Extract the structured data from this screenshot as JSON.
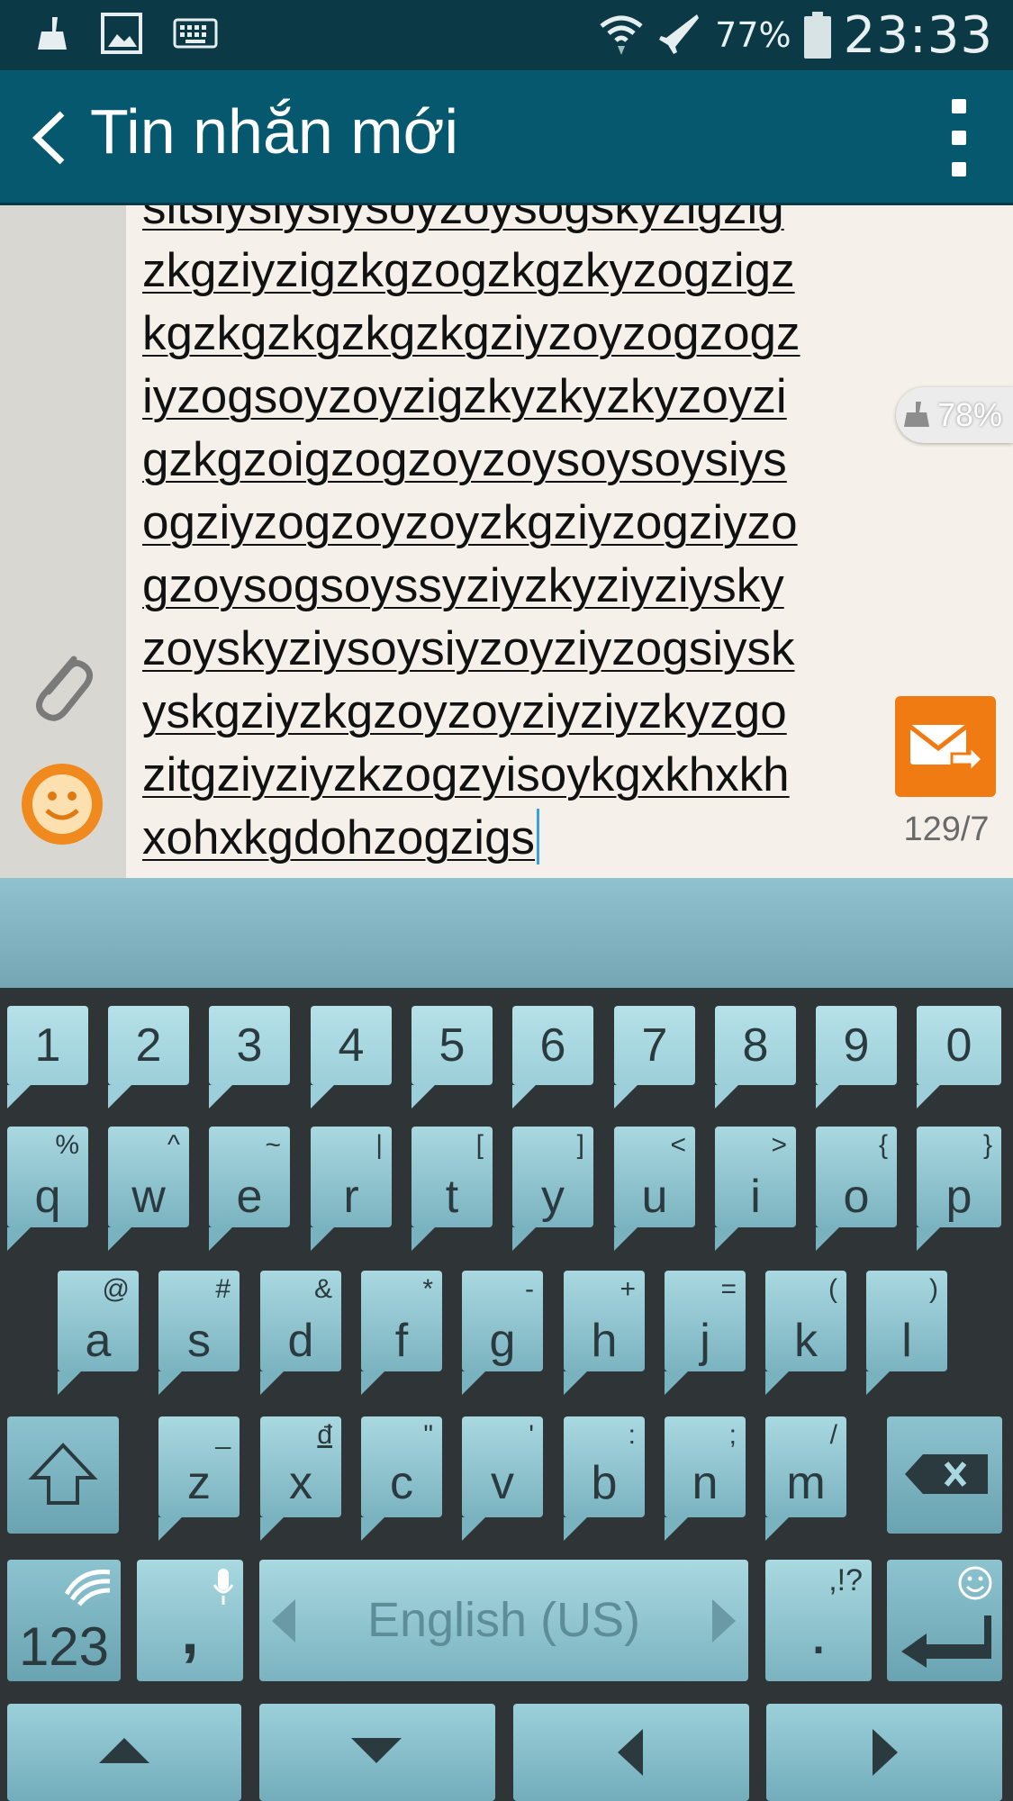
{
  "status_bar": {
    "battery_percent": "77%",
    "time": "23:33",
    "icons": [
      "broom-icon",
      "image-icon",
      "keyboard-icon",
      "wifi-icon",
      "airplane-mode-icon",
      "battery-icon"
    ]
  },
  "app_bar": {
    "title": "Tin nhắn mới",
    "back_icon": "chevron-left-icon",
    "menu_icon": "overflow-menu-icon"
  },
  "compose": {
    "message_lines": [
      "sitsiysiysiysoyzoysogskyzigzig",
      "zkgziyzigzkgzogzkgzkyzogzigz",
      "kgzkgzkgzkgzkgziyzoyzogzogz",
      "iyzogsoyzoyzigzkyzkyzkyzoyzi",
      "gzkgzoigzogzoyzoysoysoysiys",
      "ogziyzogzoyzoyzkgziyzogziyzo",
      "gzoysogsoyssyziyzkyziyziysky",
      "zoyskyziysoysiyzoyziyzogsiysk",
      "yskgziyzkgzoyzoyziyziyzkyzgo",
      "zitgziyziyzkzogzyisoykgxkhxkh",
      "xohxkgdohzogzigs"
    ],
    "battery_badge": "78%",
    "counter": "129/7",
    "send_icon": "send-message-icon",
    "attach_icon": "paperclip-icon",
    "emoji_icon": "smiley-icon",
    "accent_color": "#f07b13"
  },
  "keyboard": {
    "number_row": [
      "1",
      "2",
      "3",
      "4",
      "5",
      "6",
      "7",
      "8",
      "9",
      "0"
    ],
    "q_row": [
      {
        "k": "q",
        "alt": "%"
      },
      {
        "k": "w",
        "alt": "^"
      },
      {
        "k": "e",
        "alt": "~"
      },
      {
        "k": "r",
        "alt": "|"
      },
      {
        "k": "t",
        "alt": "["
      },
      {
        "k": "y",
        "alt": "]"
      },
      {
        "k": "u",
        "alt": "<"
      },
      {
        "k": "i",
        "alt": ">"
      },
      {
        "k": "o",
        "alt": "{"
      },
      {
        "k": "p",
        "alt": "}"
      }
    ],
    "a_row": [
      {
        "k": "a",
        "alt": "@"
      },
      {
        "k": "s",
        "alt": "#"
      },
      {
        "k": "d",
        "alt": "&"
      },
      {
        "k": "f",
        "alt": "*"
      },
      {
        "k": "g",
        "alt": "-"
      },
      {
        "k": "h",
        "alt": "+"
      },
      {
        "k": "j",
        "alt": "="
      },
      {
        "k": "k",
        "alt": "("
      },
      {
        "k": "l",
        "alt": ")"
      }
    ],
    "z_row": [
      {
        "k": "z",
        "alt": "_"
      },
      {
        "k": "x",
        "alt": "đ"
      },
      {
        "k": "c",
        "alt": "\""
      },
      {
        "k": "v",
        "alt": "'"
      },
      {
        "k": "b",
        "alt": ":"
      },
      {
        "k": "n",
        "alt": ";"
      },
      {
        "k": "m",
        "alt": "/"
      }
    ],
    "symbols_label": "123",
    "comma_label": ",",
    "space_label": "English (US)",
    "period_label": ".",
    "period_alt": ",!?",
    "shift_icon": "shift-icon",
    "backspace_icon": "backspace-icon",
    "enter_icon": "enter-icon",
    "mic_icon": "microphone-icon",
    "swiftkey_icon": "swiftkey-logo-icon",
    "nav_icons": [
      "arrow-up-icon",
      "arrow-down-icon",
      "arrow-left-icon",
      "arrow-right-icon"
    ]
  }
}
